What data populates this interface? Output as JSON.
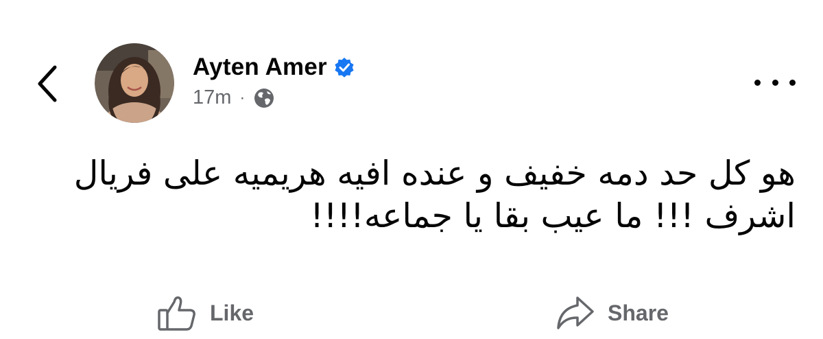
{
  "header": {
    "author_name": "Ayten Amer",
    "verified": true,
    "timestamp": "17m",
    "separator": "·",
    "audience_icon": "globe-icon"
  },
  "post": {
    "text": "هو كل حد دمه خفيف و عنده افيه هريميه على فريال اشرف !!! ما عيب بقا يا جماعه!!!!"
  },
  "actions": {
    "like_label": "Like",
    "share_label": "Share"
  },
  "icons": {
    "back": "chevron-left-icon",
    "more": "more-horizontal-icon",
    "like": "thumbs-up-icon",
    "share": "share-arrow-icon"
  },
  "colors": {
    "verified_blue": "#1877f2",
    "secondary_text": "#65676b",
    "primary_text": "#050505"
  }
}
